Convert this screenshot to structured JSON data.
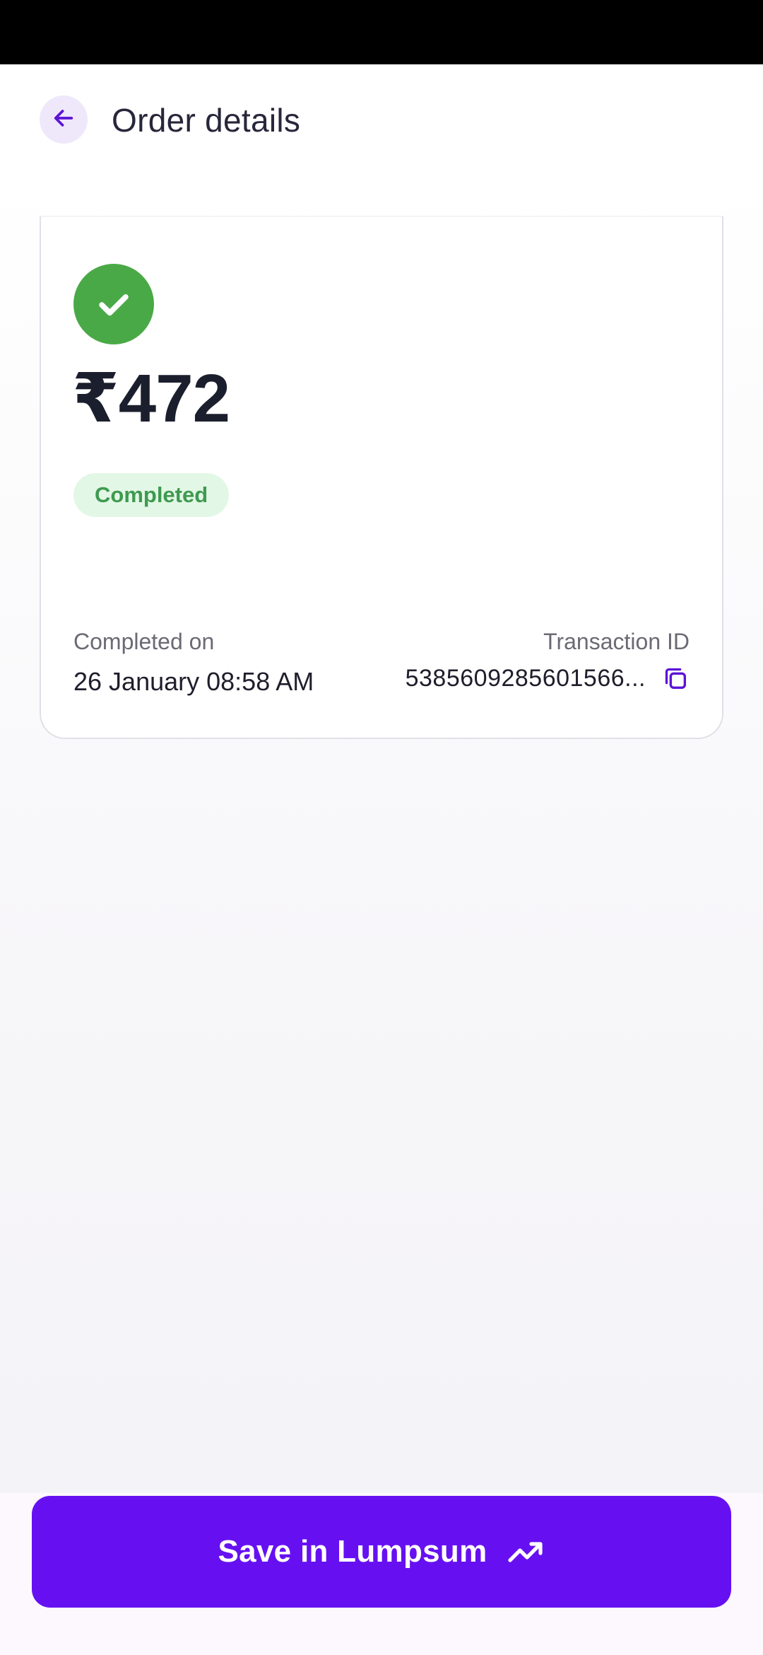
{
  "header": {
    "title": "Order details",
    "back_icon": "arrow-left-icon"
  },
  "order": {
    "amount": "₹472",
    "status": "Completed",
    "status_icon": "check-circle-icon",
    "completed_on_label": "Completed on",
    "completed_on_value": "26 January 08:58 AM",
    "transaction_id_label": "Transaction ID",
    "transaction_id_value": "5385609285601566...",
    "copy_icon": "copy-icon"
  },
  "cta": {
    "label": "Save in Lumpsum",
    "icon": "trending-up-icon"
  },
  "colors": {
    "accent": "#6610f2",
    "success": "#4aa947",
    "success_badge_bg": "#e3f7e6",
    "success_badge_text": "#3e9a4f"
  }
}
